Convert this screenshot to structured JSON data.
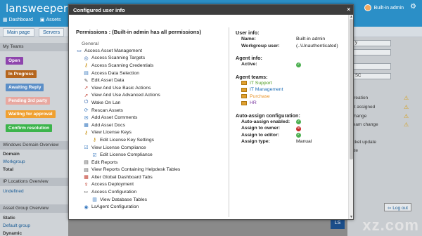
{
  "app": {
    "brand": "lansweeper",
    "nav": [
      {
        "label": "Dashboard",
        "icon": "dashboard-icon"
      },
      {
        "label": "Assets",
        "icon": "assets-icon"
      }
    ],
    "user": "Built-in admin",
    "subtabs": [
      "Main page",
      "Servers"
    ]
  },
  "left_panels": {
    "my_teams": "My Teams",
    "statuses": [
      {
        "label": "Open",
        "color": "#8e44ad"
      },
      {
        "label": "In Progress",
        "color": "#b5651d"
      },
      {
        "label": "Awaiting Reply",
        "color": "#5b8ec7"
      },
      {
        "label": "Pending 3rd party",
        "color": "#e8a8a0"
      },
      {
        "label": "Waiting for approval",
        "color": "#f0a030"
      },
      {
        "label": "Confirm resolution",
        "color": "#3cb44b"
      }
    ],
    "windows_domain": {
      "title": "Windows Domain Overview",
      "header": "Domain",
      "rows": [
        "Workgroup",
        "Total"
      ]
    },
    "ip_locations": {
      "title": "IP Locations Overview",
      "rows": [
        "Undefined"
      ]
    },
    "asset_group": {
      "title": "Asset Group Overview",
      "header": "Static",
      "rows": [
        "Default group",
        "Dynamic"
      ]
    }
  },
  "right_panel": {
    "select_values": [
      "y",
      "",
      "",
      "SC"
    ],
    "texts": [
      "creation",
      "et assigned",
      "change",
      "team change",
      "icket update",
      "ate"
    ],
    "logout": "Log out"
  },
  "modal": {
    "title": "Configured user info",
    "close": "×",
    "permissions_title": "Permissions : (Built-in admin has all permissions)",
    "group_label": "General",
    "permissions": [
      {
        "label": "Access Asset Management",
        "indent": 0,
        "icon": "monitor-icon"
      },
      {
        "label": "Access Scanning Targets",
        "indent": 1,
        "icon": "scan-icon"
      },
      {
        "label": "Access Scanning Credentials",
        "indent": 1,
        "icon": "key-icon"
      },
      {
        "label": "Access Data Selection",
        "indent": 1,
        "icon": "database-icon"
      },
      {
        "label": "Edit Asset Data",
        "indent": 1,
        "icon": "edit-icon"
      },
      {
        "label": "View And Use Basic Actions",
        "indent": 1,
        "icon": "action-icon"
      },
      {
        "label": "View And Use Advanced Actions",
        "indent": 1,
        "icon": "action-icon"
      },
      {
        "label": "Wake On Lan",
        "indent": 1,
        "icon": "power-icon"
      },
      {
        "label": "Rescan Assets",
        "indent": 1,
        "icon": "rescan-icon"
      },
      {
        "label": "Add Asset Comments",
        "indent": 1,
        "icon": "comment-icon"
      },
      {
        "label": "Add Asset Docs",
        "indent": 1,
        "icon": "doc-icon"
      },
      {
        "label": "View License Keys",
        "indent": 1,
        "icon": "key-icon"
      },
      {
        "label": "Edit License Key Settings",
        "indent": 2,
        "icon": "key-icon"
      },
      {
        "label": "View License Compliance",
        "indent": 1,
        "icon": "compliance-icon"
      },
      {
        "label": "Edit License Compliance",
        "indent": 2,
        "icon": "compliance-icon"
      },
      {
        "label": "Edit Reports",
        "indent": 1,
        "icon": "report-icon"
      },
      {
        "label": "View Reports Containing Helpdesk Tables",
        "indent": 1,
        "icon": "report-icon"
      },
      {
        "label": "Alter Global Dashboard Tabs",
        "indent": 1,
        "icon": "dashboard-icon"
      },
      {
        "label": "Access Deployment",
        "indent": 1,
        "icon": "deploy-icon"
      },
      {
        "label": "Access Configuration",
        "indent": 1,
        "icon": "wrench-icon"
      },
      {
        "label": "View Database Tables",
        "indent": 2,
        "icon": "table-icon"
      },
      {
        "label": "LsAgent Configuration",
        "indent": 1,
        "icon": "agent-icon"
      }
    ],
    "user_info": {
      "title": "User info:",
      "name_label": "Name:",
      "name_value": "Built-in admin",
      "workgroup_label": "Workgroup user:",
      "workgroup_value": "(..\\Unauthenticated)"
    },
    "agent_info": {
      "title": "Agent info:",
      "active_label": "Active:"
    },
    "agent_teams": {
      "title": "Agent teams:",
      "teams": [
        {
          "label": "IT Support",
          "color": "#4a9a1a"
        },
        {
          "label": "IT Management",
          "color": "#1a6cb5"
        },
        {
          "label": "Purchase",
          "color": "#e89020"
        },
        {
          "label": "HR",
          "color": "#7a3aa0"
        }
      ]
    },
    "auto_assign": {
      "title": "Auto-assign configuration:",
      "enabled_label": "Auto-assign enabled:",
      "owner_label": "Assign to owner:",
      "editor_label": "Assign to editor:",
      "type_label": "Assign type:",
      "type_value": "Manual"
    }
  },
  "watermark": "xz.com",
  "watermark_logo": "LS"
}
